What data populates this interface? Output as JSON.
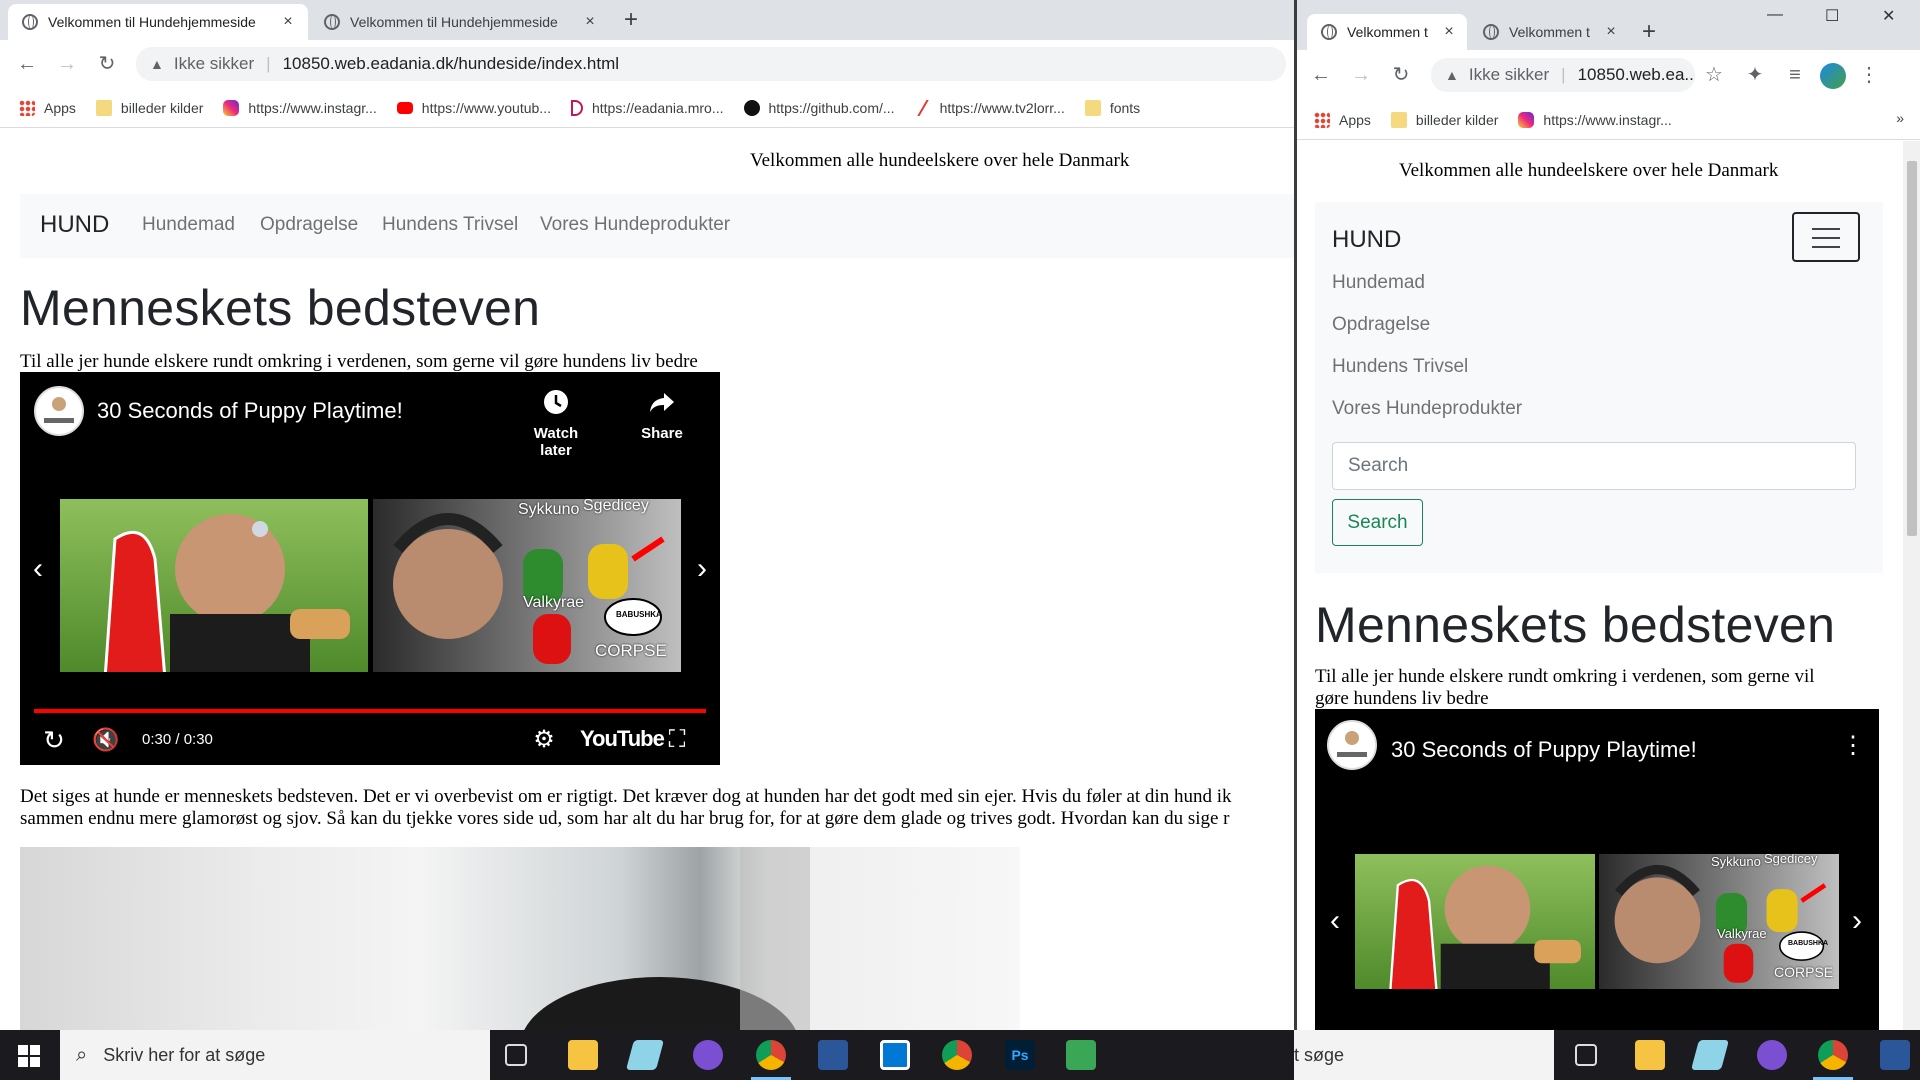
{
  "left_window": {
    "tabs": [
      {
        "title": "Velkommen til Hundehjemmeside",
        "close": "×"
      },
      {
        "title": "Velkommen til Hundehjemmeside",
        "close": "×"
      }
    ],
    "new_tab": "+",
    "address": {
      "security": "Ikke sikker",
      "url": "10850.web.eadania.dk/hundeside/index.html"
    },
    "bookmarks": [
      "Apps",
      "billeder kilder",
      "https://www.instagr...",
      "https://www.youtub...",
      "https://eadania.mro...",
      "https://github.com/...",
      "https://www.tv2lorr...",
      "fonts"
    ],
    "page": {
      "tagline": "Velkommen alle hundeelskere over hele Danmark",
      "brand": "HUND",
      "nav": [
        "Hundemad",
        "Opdragelse",
        "Hundens Trivsel",
        "Vores Hundeprodukter"
      ],
      "heading": "Menneskets bedsteven",
      "intro": "Til alle jer hunde elskere rundt omkring i verdenen, som gerne vil gøre hundens liv bedre",
      "video": {
        "title": "30 Seconds of Puppy Playtime!",
        "watch_later": "Watch later",
        "share": "Share",
        "time": "0:30 / 0:30",
        "brand": "YouTube",
        "progress": 1.0,
        "thumb_labels": [
          "Sykkuno",
          "Sgedicey",
          "Valkyrae",
          "BABUSHKA",
          "CORPSE"
        ]
      },
      "paragraph_line1": "Det siges at hunde er menneskets bedsteven. Det er vi overbevist om er rigtigt. Det kræver dog at hunden har det godt med sin ejer. Hvis du føler at din hund ik",
      "paragraph_line2": "sammen endnu mere glamorøst og sjov. Så kan du tjekke vores side ud, som har alt du har brug for, for at gøre dem glade og trives godt. Hvordan kan du sige r"
    }
  },
  "right_window": {
    "tabs": [
      {
        "title": "Velkommen t",
        "close": "×"
      },
      {
        "title": "Velkommen t",
        "close": "×"
      }
    ],
    "new_tab": "+",
    "window_controls": {
      "minimize": "—",
      "maximize": "☐",
      "close": "✕"
    },
    "address": {
      "security": "Ikke sikker",
      "url": "10850.web.ea..."
    },
    "bookmarks": [
      "Apps",
      "billeder kilder",
      "https://www.instagr..."
    ],
    "bookmarks_more": "»",
    "page": {
      "tagline": "Velkommen alle hundeelskere over hele Danmark",
      "brand": "HUND",
      "nav": [
        "Hundemad",
        "Opdragelse",
        "Hundens Trivsel",
        "Vores Hundeprodukter"
      ],
      "search_placeholder": "Search",
      "search_button": "Search",
      "heading": "Menneskets bedsteven",
      "intro_line1": "Til alle jer hunde elskere rundt omkring i verdenen, som gerne vil",
      "intro_line2": "gøre hundens liv bedre",
      "video": {
        "title": "30 Seconds of Puppy Playtime!",
        "menu": "⋮",
        "thumb_labels": [
          "Sykkuno",
          "Sgedicey",
          "Valkyrae",
          "BABUSHKA",
          "CORPSE"
        ]
      }
    }
  },
  "taskbar": {
    "search_placeholder": "Skriv her for at søge",
    "search_placeholder_right": "t søge"
  },
  "colors": {
    "bootstrap_success": "#198754",
    "youtube_red": "#ff0000",
    "taskbar": "#1b1b1f"
  }
}
